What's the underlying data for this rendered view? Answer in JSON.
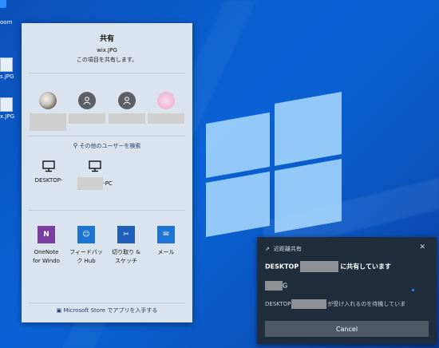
{
  "desktop": {
    "icon_labels": [
      "oom",
      "s.JPG",
      "x.JPG"
    ]
  },
  "share_panel": {
    "title": "共有",
    "file_name": "wix.JPG",
    "subtitle": "この項目を共有します。",
    "find_users": "その他のユーザーを検索",
    "devices": [
      {
        "name": "DESKTOP-"
      },
      {
        "name": "-PC"
      }
    ],
    "apps": [
      {
        "label": "OneNote for Windo",
        "tile_color": "#7a3ea0",
        "icon": "onenote-icon"
      },
      {
        "label": "フィードバック Hub",
        "tile_color": "#1e74d3",
        "icon": "feedback-hub-icon"
      },
      {
        "label": "切り取り & スケッチ",
        "tile_color": "#1f5fb8",
        "icon": "snip-sketch-icon"
      },
      {
        "label": "メール",
        "tile_color": "#1e74d3",
        "icon": "mail-icon"
      }
    ],
    "store_link": "Microsoft Store でアプリを入手する"
  },
  "toast": {
    "header": "近距離共有",
    "close_glyph": "✕",
    "title_prefix": "DESKTOP",
    "title_suffix": "に共有しています",
    "file_suffix": "G",
    "status_prefix": "DESKTOP",
    "status_suffix": "が受け入れるのを待機していま",
    "cancel_label": "Cancel"
  }
}
